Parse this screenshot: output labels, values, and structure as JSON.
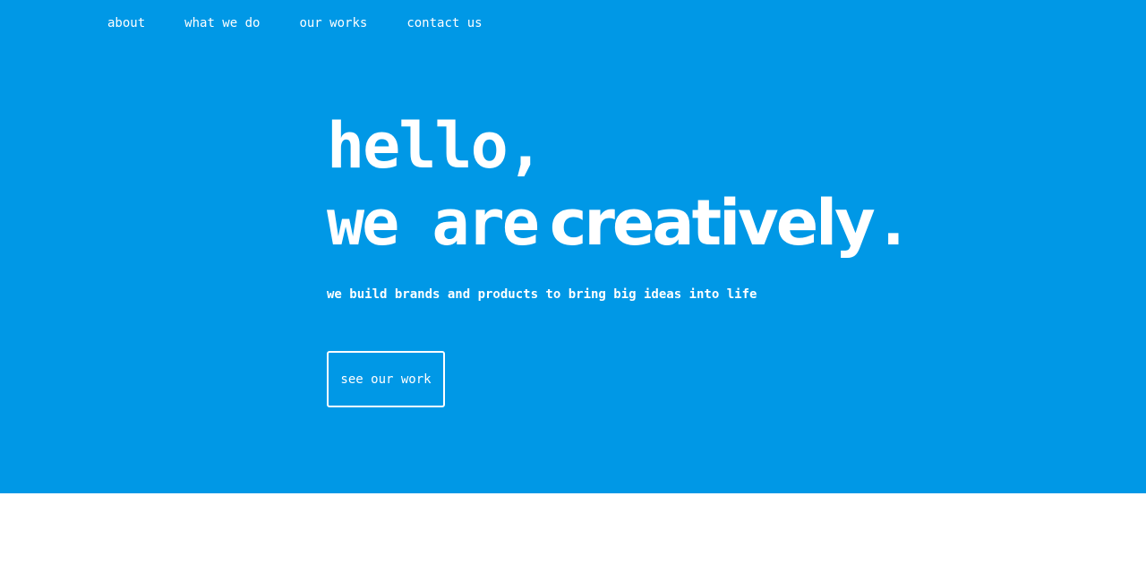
{
  "colors": {
    "hero_background": "#0098e6",
    "text": "#ffffff",
    "page_background": "#ffffff"
  },
  "nav": {
    "items": [
      {
        "label": "about"
      },
      {
        "label": "what we do"
      },
      {
        "label": "our works"
      },
      {
        "label": "contact us"
      }
    ]
  },
  "hero": {
    "greeting": "hello,",
    "statement_prefix": "we are",
    "statement_emphasis": "creatively",
    "statement_suffix": ".",
    "tagline": "we build brands and products to bring big ideas into life",
    "cta_label": "see our work"
  }
}
